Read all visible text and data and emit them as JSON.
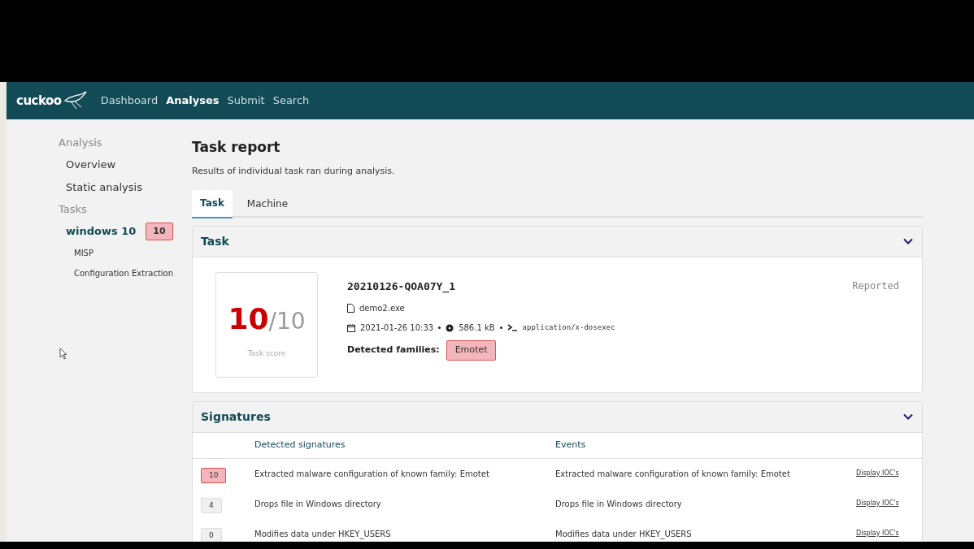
{
  "navbar": {
    "logo": "cuckoo",
    "links": [
      {
        "label": "Dashboard",
        "selected": false
      },
      {
        "label": "Analyses",
        "selected": true
      },
      {
        "label": "Submit",
        "selected": false
      },
      {
        "label": "Search",
        "selected": false
      }
    ]
  },
  "sidebar": {
    "sections": [
      {
        "heading": "Analysis",
        "items": [
          {
            "label": "Overview",
            "selected": false
          },
          {
            "label": "Static analysis",
            "selected": false
          }
        ]
      },
      {
        "heading": "Tasks",
        "items": [
          {
            "label": "windows 10",
            "selected": true,
            "badge": "10",
            "children": [
              {
                "label": "MISP",
                "selected": false
              },
              {
                "label": "Configuration Extraction",
                "selected": false
              }
            ]
          }
        ]
      }
    ]
  },
  "page": {
    "title": "Task report",
    "subtitle": "Results of individual task ran during analysis."
  },
  "tabs": [
    {
      "label": "Task",
      "selected": true
    },
    {
      "label": "Machine",
      "selected": false
    }
  ],
  "task_panel": {
    "title": "Task",
    "expanded": true,
    "score": "10",
    "score_max": "/10",
    "score_label": "Task score",
    "task_id": "20210126-QOA07Y_1",
    "status": "Reported",
    "file": "demo2.exe",
    "date": "2021-01-26 10:33",
    "size": "586.1 kB",
    "type": "application/x-dosexec",
    "families_label": "Detected families:",
    "families": [
      "Emotet"
    ]
  },
  "signatures_panel": {
    "title": "Signatures",
    "expanded": true,
    "columns": [
      "Detected signatures",
      "Events"
    ],
    "rows": [
      {
        "score": "10",
        "color": "#f4b6bd",
        "signature": "Extracted malware configuration of known family: Emotet",
        "event": "Extracted malware configuration of known family: Emotet",
        "link": "Display IOC's"
      },
      {
        "score": "4",
        "color": "#f0f0f0",
        "signature": "Drops file in Windows directory",
        "event": "Drops file in Windows directory",
        "link": "Display IOC's"
      },
      {
        "score": "0",
        "color": "#f0f0f0",
        "signature": "Modifies data under HKEY_USERS",
        "event": "Modifies data under HKEY_USERS",
        "link": "Display IOC's"
      }
    ]
  }
}
